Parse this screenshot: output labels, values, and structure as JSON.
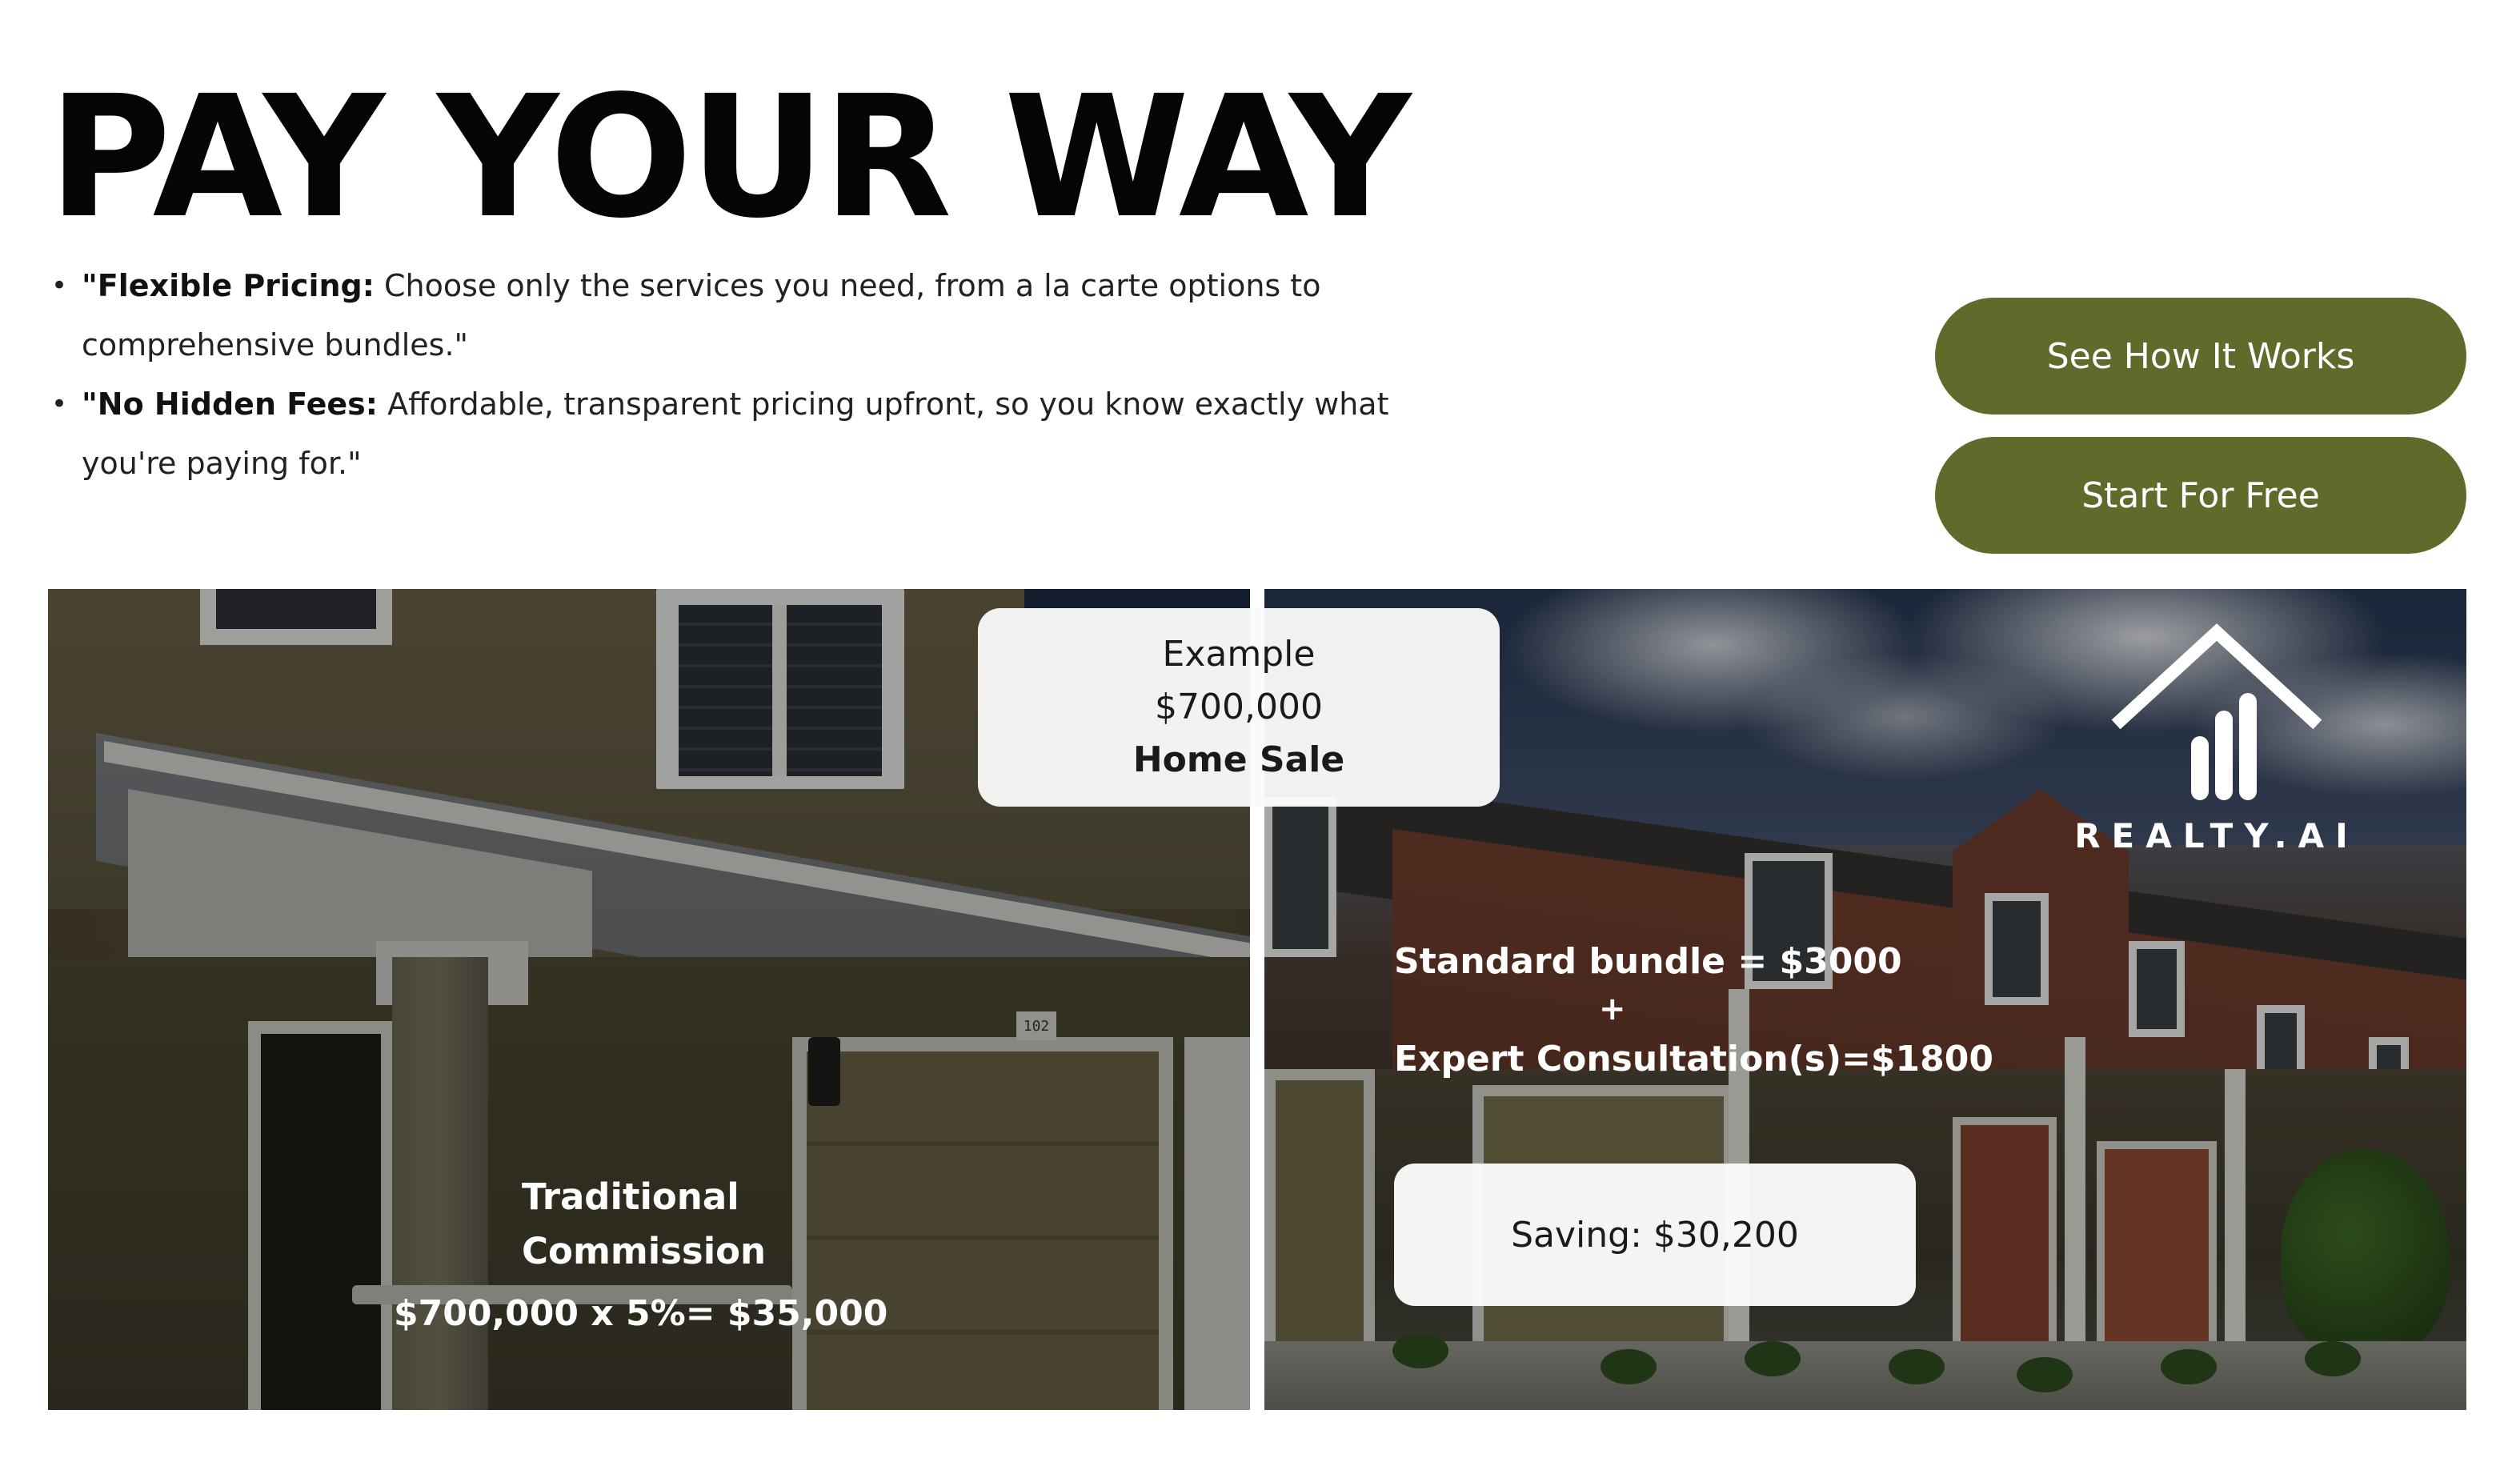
{
  "header": {
    "title": "PAY YOUR WAY"
  },
  "bullets": [
    {
      "bold": "\"Flexible Pricing:",
      "text": " Choose only the services you need, from a la carte options to comprehensive bundles.\""
    },
    {
      "bold": "\"No Hidden Fees:",
      "text": " Affordable, transparent pricing upfront, so you know exactly what you're paying for.\""
    }
  ],
  "cta": {
    "primary_label": "See How It Works",
    "secondary_label": "Start For Free",
    "color": "#5e6b2a"
  },
  "example": {
    "line1": "Example",
    "line2": "$700,000",
    "line3": "Home Sale"
  },
  "traditional": {
    "label_line1": "Traditional",
    "label_line2": "Commission",
    "formula": "$700,000 x 5%= $35,000"
  },
  "bundle": {
    "line1": "Standard bundle = $3000",
    "plus": "+",
    "line2": "Expert Consultation(s)=$1800"
  },
  "saving": {
    "label": "Saving: $30,200"
  },
  "logo": {
    "name": "house-chart-logo-icon",
    "wordmark": "REALTY.AI"
  },
  "house_number": "102"
}
